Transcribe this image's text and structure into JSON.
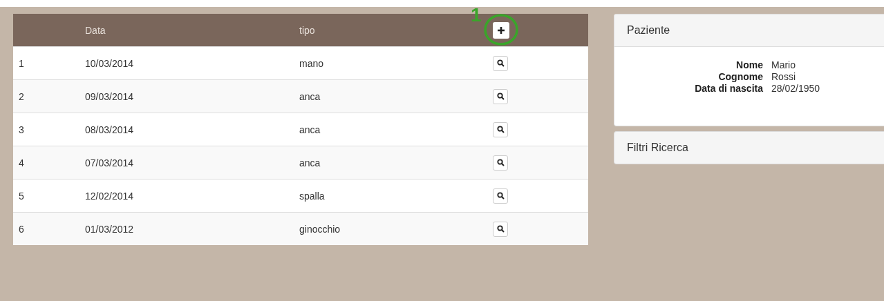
{
  "table": {
    "columns": [
      "",
      "Data",
      "tipo"
    ],
    "add_button": {
      "annotation": "1"
    },
    "rows": [
      {
        "num": "1",
        "date": "10/03/2014",
        "type": "mano"
      },
      {
        "num": "2",
        "date": "09/03/2014",
        "type": "anca"
      },
      {
        "num": "3",
        "date": "08/03/2014",
        "type": "anca"
      },
      {
        "num": "4",
        "date": "07/03/2014",
        "type": "anca"
      },
      {
        "num": "5",
        "date": "12/02/2014",
        "type": "spalla"
      },
      {
        "num": "6",
        "date": "01/03/2012",
        "type": "ginocchio"
      }
    ]
  },
  "patient_panel": {
    "title": "Paziente",
    "fields": [
      {
        "label": "Nome",
        "value": "Mario"
      },
      {
        "label": "Cognome",
        "value": "Rossi"
      },
      {
        "label": "Data di nascita",
        "value": "28/02/1950"
      }
    ]
  },
  "filters_panel": {
    "title": "Filtri Ricerca"
  }
}
